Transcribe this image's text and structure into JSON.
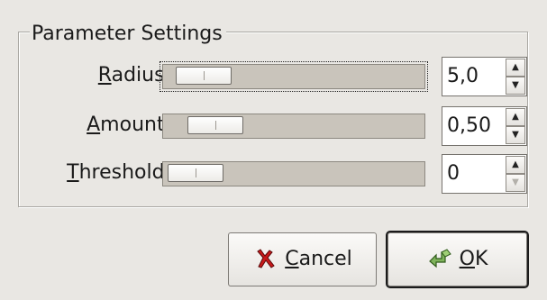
{
  "group": {
    "title": "Parameter Settings"
  },
  "rows": [
    {
      "label_mnemonic": "R",
      "label_rest": "adius:",
      "value": "5,0",
      "slider_fraction": 0.04,
      "focused": true,
      "down_disabled": false
    },
    {
      "label_mnemonic": "A",
      "label_rest": "mount:",
      "value": "0,50",
      "slider_fraction": 0.1,
      "focused": false,
      "down_disabled": false
    },
    {
      "label_mnemonic": "T",
      "label_rest": "hreshold:",
      "value": "0",
      "slider_fraction": 0.0,
      "focused": false,
      "down_disabled": true
    }
  ],
  "buttons": {
    "cancel_mnemonic": "C",
    "cancel_rest": "ancel",
    "cancel_icon": "red-x-icon",
    "ok_mnemonic": "O",
    "ok_rest": "K",
    "ok_icon": "green-check-arrow-icon"
  },
  "spin_up_glyph": "▲",
  "spin_down_glyph": "▼"
}
